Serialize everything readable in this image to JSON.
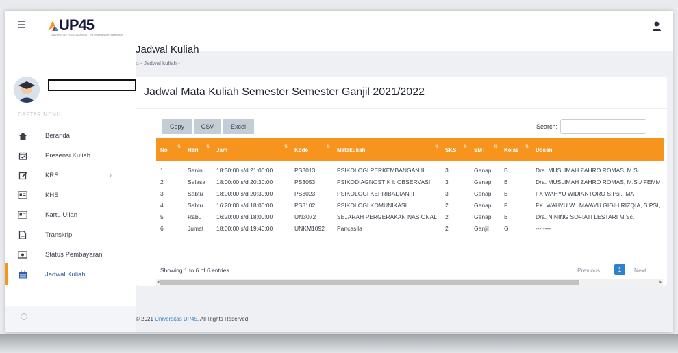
{
  "header": {
    "logo_text": "UP45",
    "logo_tagline": "UNIVERSITAS PROKLAMASI 45 · The University of Proclamation"
  },
  "sidebar": {
    "menu_title": "DAFTAR MENU",
    "items": [
      {
        "label": "Beranda",
        "icon": "home-icon"
      },
      {
        "label": "Presensi Kuliah",
        "icon": "calendar-check-icon"
      },
      {
        "label": "KRS",
        "icon": "edit-icon",
        "chevron": "›"
      },
      {
        "label": "KHS",
        "icon": "id-card-icon"
      },
      {
        "label": "Kartu Ujian",
        "icon": "id-card-icon"
      },
      {
        "label": "Transkrip",
        "icon": "document-icon"
      },
      {
        "label": "Status Pembayaran",
        "icon": "money-icon"
      },
      {
        "label": "Jadwal Kuliah",
        "icon": "calendar-icon",
        "active": true
      }
    ]
  },
  "page": {
    "title": "Jadwal Kuliah",
    "breadcrumb": "⌂ - Jadwal kuliah -"
  },
  "card": {
    "title": "Jadwal Mata Kuliah Semester Semester Ganjil 2021/2022",
    "buttons": [
      "Copy",
      "CSV",
      "Excel"
    ],
    "search_label": "Search:",
    "search_value": ""
  },
  "table": {
    "columns": [
      "No",
      "Hari",
      "Jam",
      "Kode",
      "Matakuliah",
      "SKS",
      "SMT",
      "Kelas",
      "Dosen"
    ],
    "rows": [
      [
        "1",
        "Senin",
        "18:30:00 s/d 21:00:00",
        "PS3013",
        "PSIKOLOGI PERKEMBANGAN II",
        "3",
        "Genap",
        "B",
        "Dra. MUSLIMAH ZAHRO ROMAS, M.Si."
      ],
      [
        "2",
        "Selasa",
        "18:00:00 s/d 20:30:00",
        "PS3053",
        "PSIKODIAGNOSTIK I: OBSERVASI",
        "3",
        "Genap",
        "B",
        "Dra. MUSLIMAH ZAHRO ROMAS, M.Si./ FEMM"
      ],
      [
        "3",
        "Sabtu",
        "18:00:00 s/d 20:30:00",
        "PS3023",
        "PSIKOLOGI KEPRIBADIAN II",
        "3",
        "Genap",
        "B",
        "FX WAHYU WIDIANTORO S.Psi., MA"
      ],
      [
        "4",
        "Sabtu",
        "16:20:00 s/d 18:00:00",
        "PS3102",
        "PSIKOLOGI KOMUNIKASI",
        "2",
        "Genap",
        "F",
        "FX. WAHYU W., MA/AYU GIGIH RIZQIA, S.PSI,"
      ],
      [
        "5",
        "Rabu",
        "16:20:00 s/d 18:00:00",
        "UN3072",
        "SEJARAH PERGERAKAN NASIONAL",
        "2",
        "Genap",
        "B",
        "Dra. NINING SOFIATI LESTARI M.Sc."
      ],
      [
        "6",
        "Jumat",
        "18:00:00 s/d 19:40:00",
        "UNKM1092",
        "Pancasila",
        "2",
        "Ganjil",
        "G",
        "--- ----"
      ]
    ],
    "info": "Showing 1 to 6 of 6 entries",
    "pagination": {
      "previous": "Previous",
      "current": "1",
      "next": "Next"
    }
  },
  "footer": {
    "prefix": "© 2021 ",
    "link": "Universitas UP45",
    "suffix": ". All Rights Reserved."
  },
  "colors": {
    "accent": "#f7941d",
    "link": "#2f82c9",
    "active_nav": "#2f5fa7"
  }
}
